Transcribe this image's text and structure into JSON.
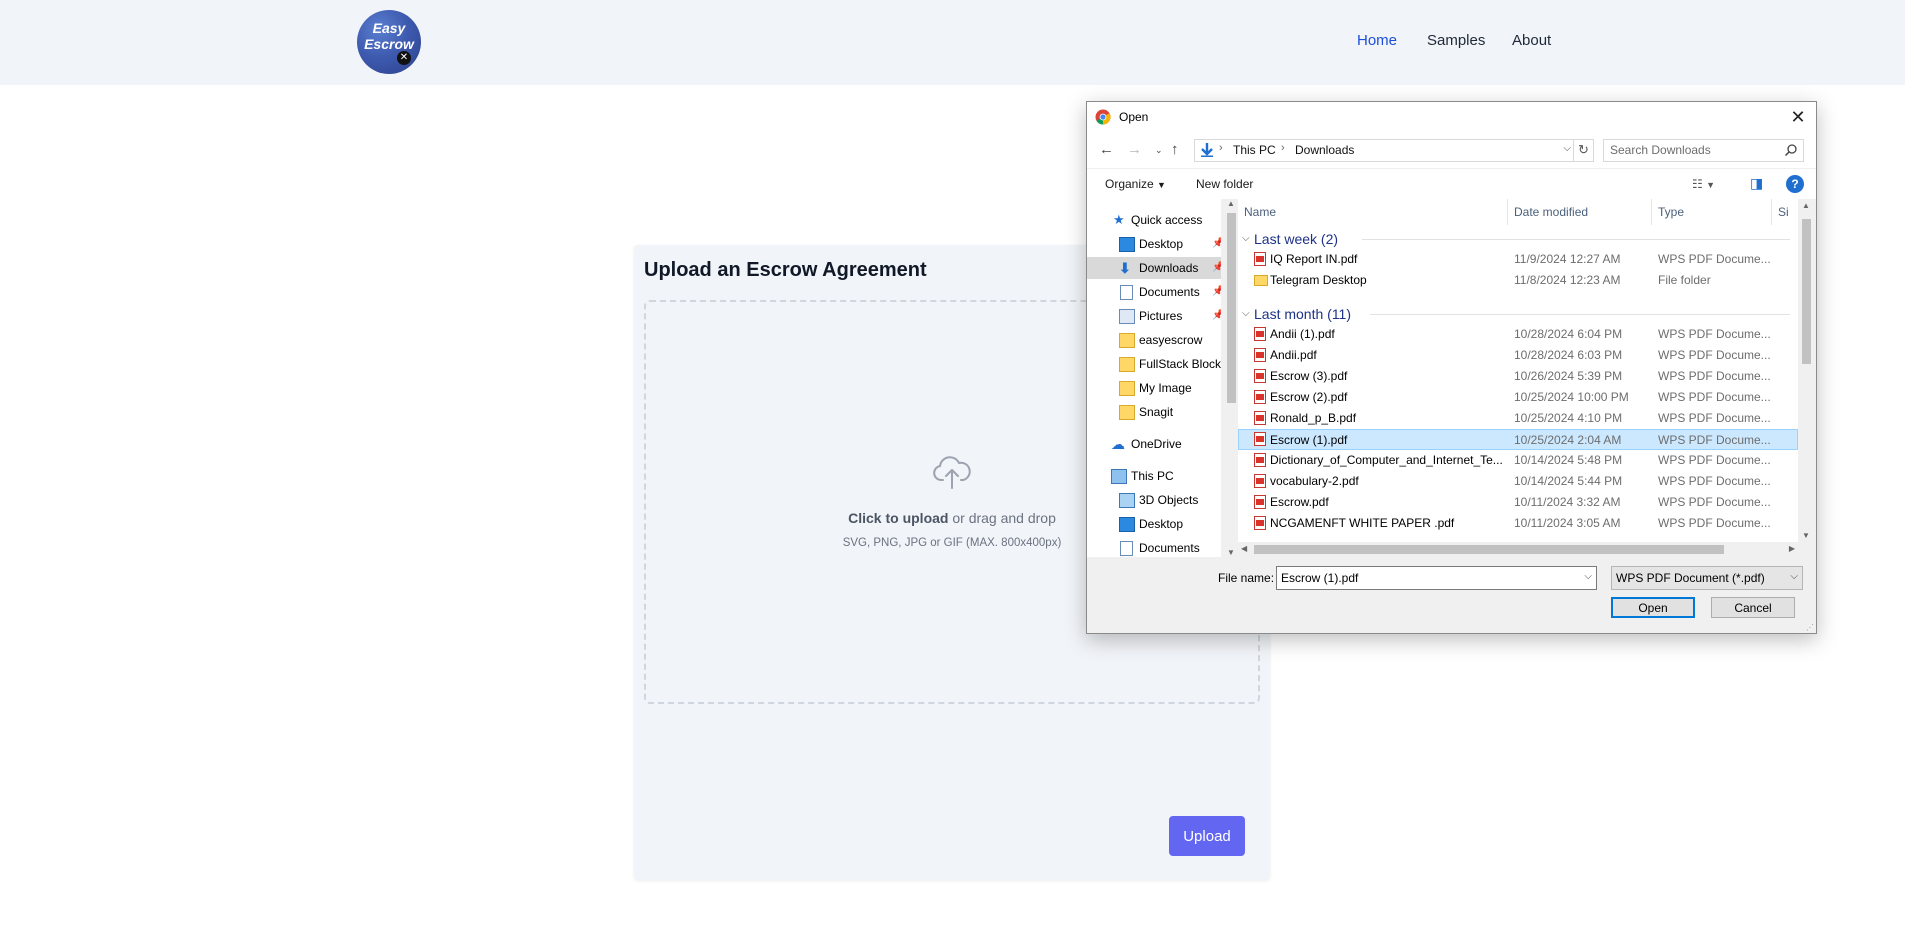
{
  "header": {
    "logo_text": "Easy Escrow",
    "nav": [
      {
        "label": "Home",
        "active": true
      },
      {
        "label": "Samples",
        "active": false
      },
      {
        "label": "About",
        "active": false
      }
    ]
  },
  "upload": {
    "title": "Upload an Escrow Agreement",
    "click_text": "Click to upload",
    "drag_text": " or drag and drop",
    "hint": "SVG, PNG, JPG or GIF (MAX. 800x400px)",
    "button": "Upload",
    "accent": "#6366f1"
  },
  "dialog": {
    "title": "Open",
    "breadcrumb": [
      "This PC",
      "Downloads"
    ],
    "search_placeholder": "Search Downloads",
    "toolbar": {
      "organize": "Organize",
      "new_folder": "New folder"
    },
    "nav_pane": [
      {
        "label": "Quick access",
        "icon": "star-icon",
        "pin": false,
        "indent": 1
      },
      {
        "label": "Desktop",
        "icon": "desktop-icon",
        "pin": true,
        "indent": 2
      },
      {
        "label": "Downloads",
        "icon": "download-icon",
        "pin": true,
        "indent": 2,
        "selected": true
      },
      {
        "label": "Documents",
        "icon": "document-icon",
        "pin": true,
        "indent": 2
      },
      {
        "label": "Pictures",
        "icon": "pictures-icon",
        "pin": true,
        "indent": 2
      },
      {
        "label": "easyescrow",
        "icon": "folder-icon",
        "pin": false,
        "indent": 2
      },
      {
        "label": "FullStack Blockc",
        "icon": "folder-icon",
        "pin": false,
        "indent": 2
      },
      {
        "label": "My Image",
        "icon": "folder-icon",
        "pin": false,
        "indent": 2
      },
      {
        "label": "Snagit",
        "icon": "folder-icon",
        "pin": false,
        "indent": 2
      },
      {
        "label": "OneDrive",
        "icon": "cloud-icon",
        "pin": false,
        "indent": 1
      },
      {
        "label": "This PC",
        "icon": "pc-icon",
        "pin": false,
        "indent": 1
      },
      {
        "label": "3D Objects",
        "icon": "cube-icon",
        "pin": false,
        "indent": 2
      },
      {
        "label": "Desktop",
        "icon": "desktop-icon",
        "pin": false,
        "indent": 2
      },
      {
        "label": "Documents",
        "icon": "document-icon",
        "pin": false,
        "indent": 2
      }
    ],
    "columns": [
      "Name",
      "Date modified",
      "Type",
      "Si"
    ],
    "groups": [
      {
        "label": "Last week (2)",
        "files": [
          {
            "name": "IQ Report IN.pdf",
            "date": "11/9/2024 12:27 AM",
            "type": "WPS PDF Docume...",
            "icon": "pdf-icon"
          },
          {
            "name": "Telegram Desktop",
            "date": "11/8/2024 12:23 AM",
            "type": "File folder",
            "icon": "folder-icon"
          }
        ]
      },
      {
        "label": "Last month (11)",
        "files": [
          {
            "name": "Andii (1).pdf",
            "date": "10/28/2024 6:04 PM",
            "type": "WPS PDF Docume...",
            "icon": "pdf-icon"
          },
          {
            "name": "Andii.pdf",
            "date": "10/28/2024 6:03 PM",
            "type": "WPS PDF Docume...",
            "icon": "pdf-icon"
          },
          {
            "name": "Escrow (3).pdf",
            "date": "10/26/2024 5:39 PM",
            "type": "WPS PDF Docume...",
            "icon": "pdf-icon"
          },
          {
            "name": "Escrow (2).pdf",
            "date": "10/25/2024 10:00 PM",
            "type": "WPS PDF Docume...",
            "icon": "pdf-icon"
          },
          {
            "name": "Ronald_p_B.pdf",
            "date": "10/25/2024 4:10 PM",
            "type": "WPS PDF Docume...",
            "icon": "pdf-icon"
          },
          {
            "name": "Escrow (1).pdf",
            "date": "10/25/2024 2:04 AM",
            "type": "WPS PDF Docume...",
            "icon": "pdf-icon",
            "selected": true
          },
          {
            "name": "Dictionary_of_Computer_and_Internet_Te...",
            "date": "10/14/2024 5:48 PM",
            "type": "WPS PDF Docume...",
            "icon": "pdf-icon"
          },
          {
            "name": "vocabulary-2.pdf",
            "date": "10/14/2024 5:44 PM",
            "type": "WPS PDF Docume...",
            "icon": "pdf-icon"
          },
          {
            "name": "Escrow.pdf",
            "date": "10/11/2024 3:32 AM",
            "type": "WPS PDF Docume...",
            "icon": "pdf-icon"
          },
          {
            "name": "NCGAMENFT WHITE PAPER .pdf",
            "date": "10/11/2024 3:05 AM",
            "type": "WPS PDF Docume...",
            "icon": "pdf-icon"
          }
        ]
      }
    ],
    "file_name_label": "File name:",
    "file_name_value": "Escrow (1).pdf",
    "file_type_value": "WPS PDF Document (*.pdf)",
    "open_label": "Open",
    "cancel_label": "Cancel"
  }
}
